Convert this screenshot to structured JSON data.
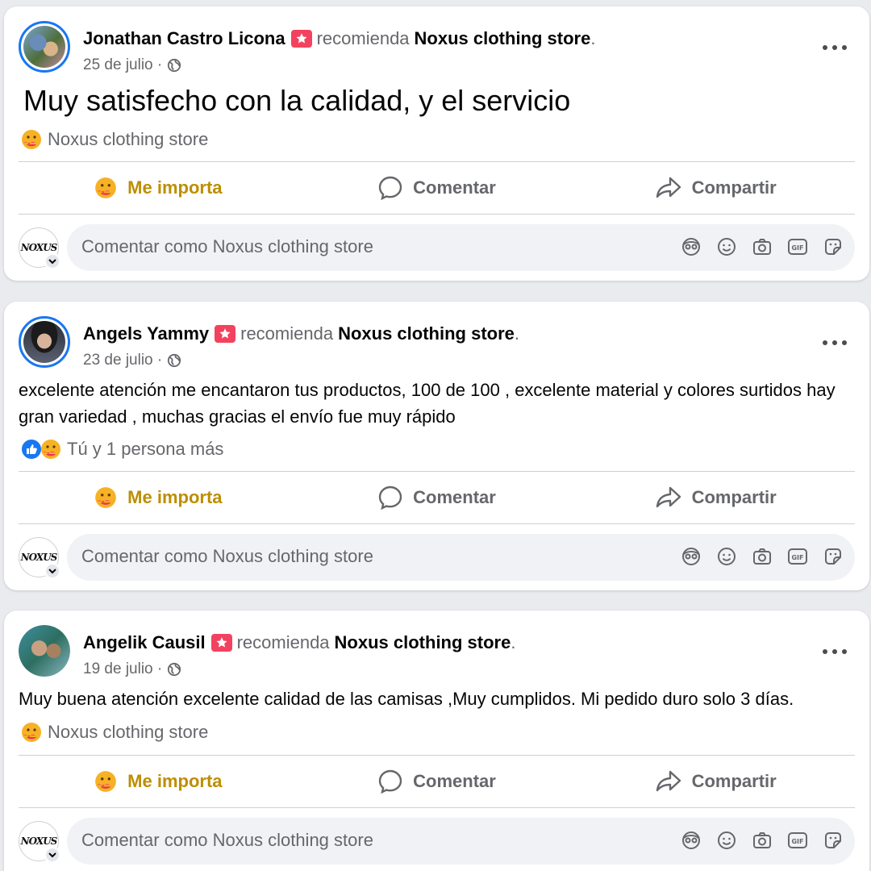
{
  "common": {
    "recommends": "recomienda",
    "page_name": "Noxus clothing store",
    "period": ".",
    "separator": "·",
    "love_label": "Me importa",
    "comment_label": "Comentar",
    "share_label": "Compartir",
    "comment_placeholder": "Comentar como Noxus clothing store",
    "commenter_avatar_text": "NOXUS"
  },
  "posts": [
    {
      "author": "Jonathan Castro Licona",
      "date": "25 de julio",
      "text": "Muy satisfecho con la calidad, y el servicio",
      "reactions_text": "Noxus clothing store"
    },
    {
      "author": "Angels Yammy",
      "date": "23 de julio",
      "text": "excelente atención me encantaron tus productos, 100 de 100 , excelente material y colores surtidos hay gran variedad , muchas gracias el envío fue muy rápido",
      "reactions_text": "Tú y 1 persona más"
    },
    {
      "author": "Angelik Causil",
      "date": "19 de julio",
      "text": "Muy buena atención excelente calidad de las camisas ,Muy cumplidos.  Mi pedido duro solo 3 días.",
      "reactions_text": "Noxus clothing store"
    }
  ],
  "colors": {
    "love_text": "#bd8e00",
    "badge": "#f3425f",
    "like_blue": "#1877f2",
    "muted": "#65676b"
  },
  "icons": [
    "globe-icon",
    "more-icon",
    "care-emoji-icon",
    "like-icon",
    "comment-icon",
    "share-icon",
    "avatar-sticker-icon",
    "emoji-icon",
    "camera-icon",
    "gif-icon",
    "sticker-icon",
    "recommend-badge-icon"
  ]
}
